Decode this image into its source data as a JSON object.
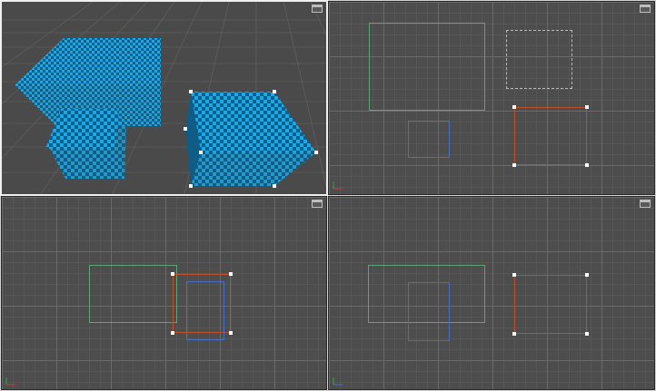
{
  "app": {
    "name": ""
  },
  "viewports": [
    {
      "id": "perspective",
      "has_maximize": true
    },
    {
      "id": "top",
      "has_maximize": true
    },
    {
      "id": "front",
      "has_maximize": true
    },
    {
      "id": "left",
      "has_maximize": true
    }
  ],
  "colors": {
    "viewport_bg": "#4d4d4d",
    "checker_a": "#1aa9e6",
    "checker_b": "#0d5f8c",
    "selected_outline": "#c0502a",
    "green_outline": "#5fa37a",
    "blue_outline": "#4a6fc2",
    "yellow_dotted_outline": "#d6c24a"
  },
  "icons": {
    "maximize": "maximize-viewport-icon",
    "axis_gizmo": "axis-gizmo-icon"
  }
}
